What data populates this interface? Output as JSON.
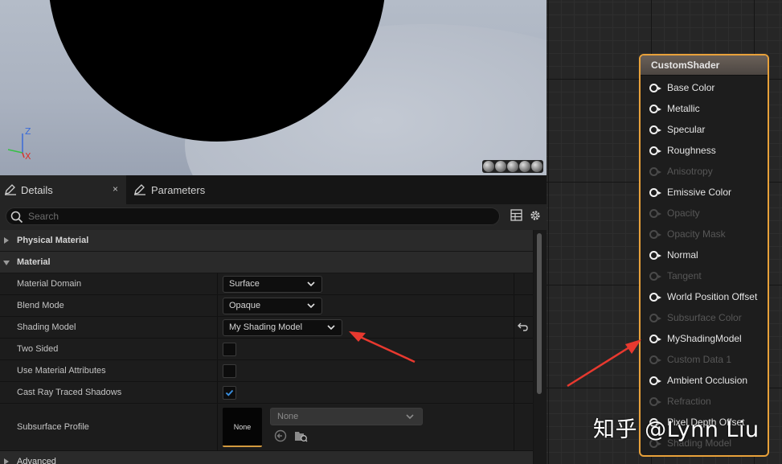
{
  "viewport": {
    "axis_z": "Z",
    "axis_x": "X"
  },
  "tabs": {
    "details": "Details",
    "details_close": "×",
    "parameters": "Parameters"
  },
  "search": {
    "placeholder": "Search"
  },
  "categories": {
    "physical_material": "Physical Material",
    "material": "Material",
    "advanced": "Advanced"
  },
  "properties": {
    "material_domain": {
      "label": "Material Domain",
      "value": "Surface"
    },
    "blend_mode": {
      "label": "Blend Mode",
      "value": "Opaque"
    },
    "shading_model": {
      "label": "Shading Model",
      "value": "My Shading Model"
    },
    "two_sided": {
      "label": "Two Sided",
      "checked": false
    },
    "use_material_attributes": {
      "label": "Use Material Attributes",
      "checked": false
    },
    "cast_ray_traced_shadows": {
      "label": "Cast Ray Traced Shadows",
      "checked": true
    },
    "subsurface_profile": {
      "label": "Subsurface Profile",
      "thumb": "None",
      "value": "None"
    }
  },
  "node": {
    "title": "CustomShader",
    "pins": [
      {
        "label": "Base Color",
        "enabled": true
      },
      {
        "label": "Metallic",
        "enabled": true
      },
      {
        "label": "Specular",
        "enabled": true
      },
      {
        "label": "Roughness",
        "enabled": true
      },
      {
        "label": "Anisotropy",
        "enabled": false
      },
      {
        "label": "Emissive Color",
        "enabled": true
      },
      {
        "label": "Opacity",
        "enabled": false
      },
      {
        "label": "Opacity Mask",
        "enabled": false
      },
      {
        "label": "Normal",
        "enabled": true
      },
      {
        "label": "Tangent",
        "enabled": false
      },
      {
        "label": "World Position Offset",
        "enabled": true
      },
      {
        "label": "Subsurface Color",
        "enabled": false
      },
      {
        "label": "MyShadingModel",
        "enabled": true
      },
      {
        "label": "Custom Data 1",
        "enabled": false
      },
      {
        "label": "Ambient Occlusion",
        "enabled": true
      },
      {
        "label": "Refraction",
        "enabled": false
      },
      {
        "label": "Pixel Depth Offset",
        "enabled": true
      },
      {
        "label": "Shading Model",
        "enabled": false
      }
    ]
  },
  "watermark": "知乎 @Lynn Liu",
  "colors": {
    "accent": "#e8a13a",
    "annotation_arrow": "#e8392f",
    "check": "#3a8fe0"
  }
}
